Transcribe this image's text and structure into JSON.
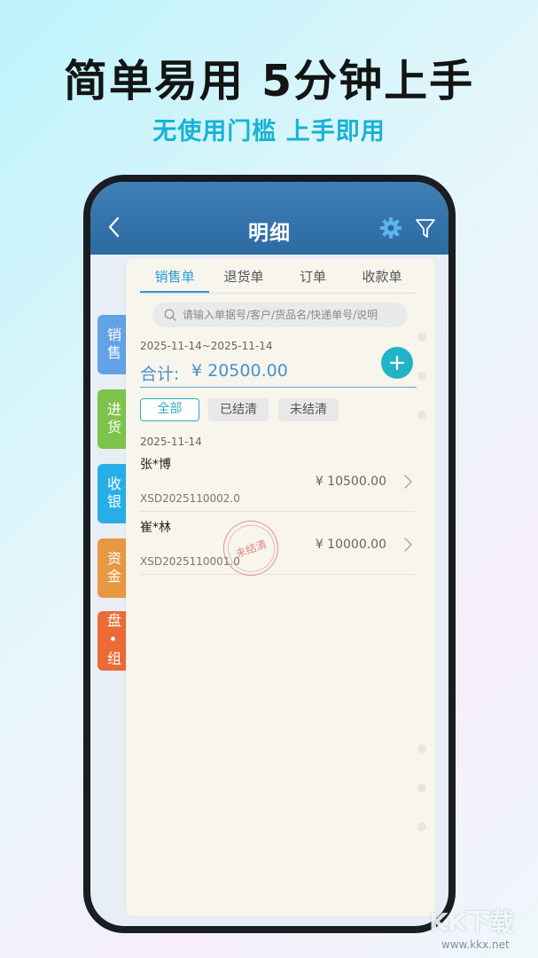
{
  "headline": "简单易用 5分钟上手",
  "subheadline": "无使用门槛 上手即用",
  "app": {
    "title": "明细",
    "icons": {
      "back": "chevron-left-icon",
      "settings": "gear-icon",
      "filter": "funnel-icon"
    }
  },
  "side_tabs": [
    {
      "label": "销售",
      "color": "#64a2e6"
    },
    {
      "label": "进货",
      "color": "#7ec34c"
    },
    {
      "label": "收银",
      "color": "#28aee6"
    },
    {
      "label": "资金",
      "color": "#e89842"
    },
    {
      "label": "盘•组",
      "color": "#ec6a35"
    }
  ],
  "top_tabs": [
    {
      "label": "销售单",
      "active": true
    },
    {
      "label": "退货单",
      "active": false
    },
    {
      "label": "订单",
      "active": false
    },
    {
      "label": "收款单",
      "active": false
    }
  ],
  "search": {
    "placeholder": "请输入单据号/客户/货品名/快递单号/说明"
  },
  "summary": {
    "date_range": "2025-11-14~2025-11-14",
    "total_label": "合计:",
    "total_value": "¥ 20500.00"
  },
  "filters": [
    {
      "label": "全部",
      "selected": true
    },
    {
      "label": "已结清",
      "selected": false
    },
    {
      "label": "未结清",
      "selected": false
    }
  ],
  "group_date": "2025-11-14",
  "orders": [
    {
      "customer": "张*博",
      "number": "XSD2025110002.0",
      "amount": "¥ 10500.00"
    },
    {
      "customer": "崔*林",
      "number": "XSD2025110001.0",
      "amount": "¥ 10000.00",
      "stamp": "未结清"
    }
  ],
  "watermark": {
    "logo": "KK下载",
    "url": "www.kkx.net"
  },
  "colors": {
    "accent": "#2f9ad6",
    "appbar": "#3f7fb6",
    "add_button": "#23b3c8",
    "headline_sub": "#16b3d4"
  }
}
